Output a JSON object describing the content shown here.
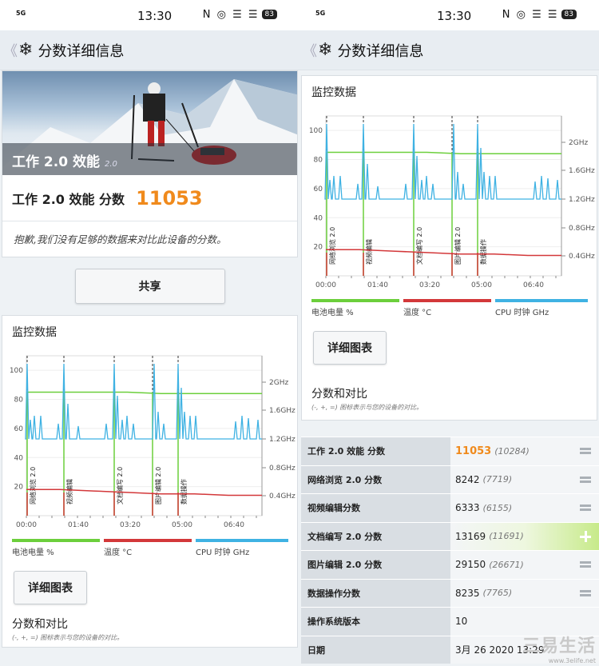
{
  "status": {
    "time": "13:30",
    "signal": "5G",
    "battery": "83",
    "icons": "N ◎ ☰ ☰"
  },
  "title": {
    "back": "《",
    "text": "分数详细信息"
  },
  "hero": {
    "name": "工作 2.0 效能",
    "version": "2.0"
  },
  "score": {
    "label": "工作 2.0 效能 分数",
    "value": "11053"
  },
  "sorry": "抱歉,我们没有足够的数据来对比此设备的分数。",
  "share_label": "共享",
  "monitor": {
    "title": "监控数据",
    "detail_label": "详细图表",
    "legend": [
      {
        "label": "电池电量 %",
        "color": "#6ccf3c"
      },
      {
        "label": "温度 °C",
        "color": "#d3383a"
      },
      {
        "label": "CPU 时钟 GHz",
        "color": "#3fb2e3"
      }
    ]
  },
  "chart_data": {
    "type": "line",
    "x_ticks": [
      "00:00",
      "01:40",
      "03:20",
      "05:00",
      "06:40"
    ],
    "y_ticks_left": [
      20,
      40,
      60,
      80,
      100
    ],
    "y_ticks_right": [
      "0.4GHz",
      "0.8GHz",
      "1.2GHz",
      "1.6GHz",
      "2GHz"
    ],
    "markers": [
      "网络浏览 2.0",
      "视频编辑",
      "文档编写 2.0",
      "图片编辑 2.0",
      "数据操作"
    ],
    "series": [
      {
        "name": "电池电量 %",
        "color": "#6ccf3c",
        "values": [
          85,
          85,
          85,
          85,
          84,
          84,
          84,
          84
        ]
      },
      {
        "name": "温度 °C",
        "color": "#d3383a",
        "values": [
          18,
          18,
          17,
          16,
          15,
          15,
          14,
          14
        ]
      },
      {
        "name": "CPU 时钟 GHz",
        "color": "#3fb2e3",
        "values": [
          1.2,
          1.2,
          1.2,
          1.2,
          1.2,
          1.2,
          1.2,
          1.2
        ]
      }
    ]
  },
  "compare": {
    "title": "分数和对比",
    "subtitle": "(-, +, =) 图标表示与您的设备的对比。",
    "rows": [
      {
        "label": "工作 2.0 效能 分数",
        "value": "11053",
        "sub": "(10284)",
        "sym": "eq",
        "highlight": false,
        "orange": true
      },
      {
        "label": "网络浏览 2.0 分数",
        "value": "8242",
        "sub": "(7719)",
        "sym": "eq",
        "highlight": false
      },
      {
        "label": "视频编辑分数",
        "value": "6333",
        "sub": "(6155)",
        "sym": "eq",
        "highlight": false
      },
      {
        "label": "文档编写 2.0 分数",
        "value": "13169",
        "sub": "(11691)",
        "sym": "plus",
        "highlight": true
      },
      {
        "label": "图片编辑 2.0 分数",
        "value": "29150",
        "sub": "(26671)",
        "sym": "eq",
        "highlight": false
      },
      {
        "label": "数据操作分数",
        "value": "8235",
        "sub": "(7765)",
        "sym": "eq",
        "highlight": false
      },
      {
        "label": "操作系统版本",
        "value": "10",
        "sub": "",
        "sym": "",
        "highlight": false
      },
      {
        "label": "日期",
        "value": "3月 26 2020 13:29",
        "sub": "",
        "sym": "",
        "highlight": false
      }
    ]
  },
  "watermark": {
    "big": "三易生活",
    "small": "www.3elife.net"
  }
}
